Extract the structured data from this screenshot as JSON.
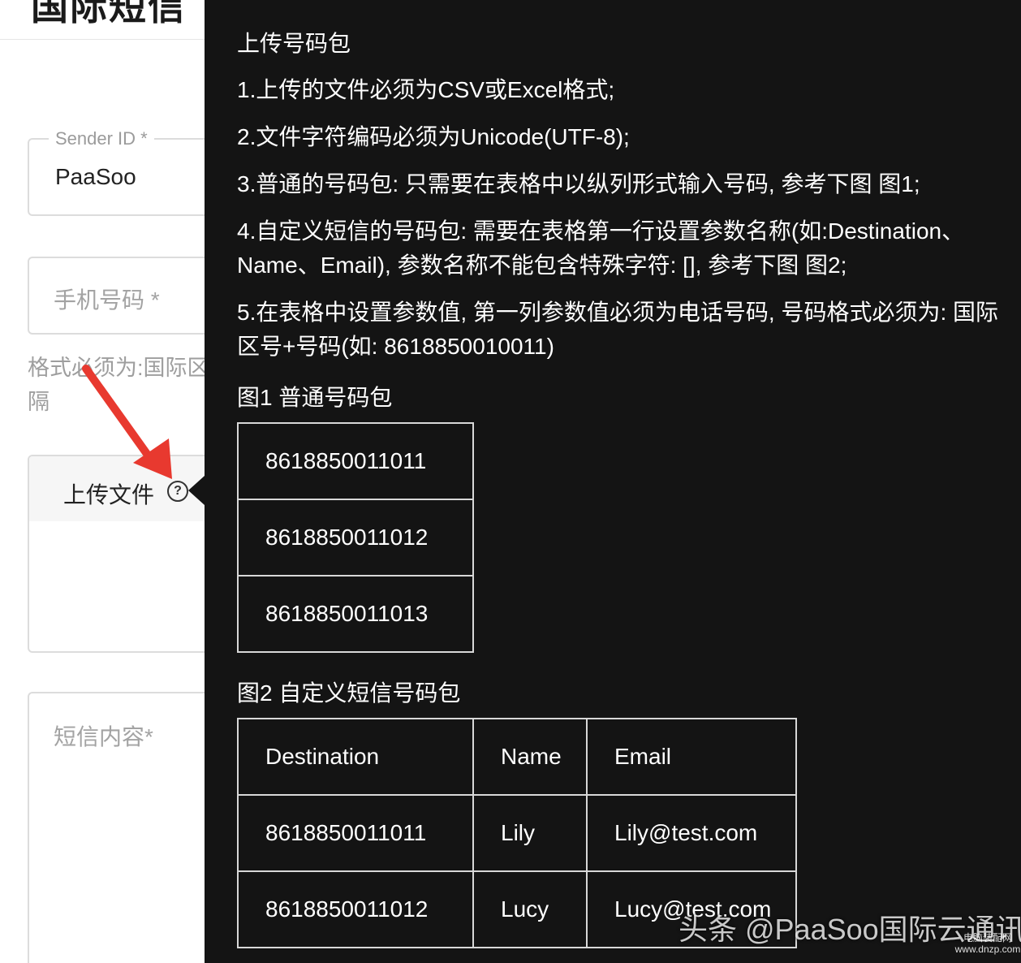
{
  "form": {
    "heading": "国际短信",
    "sender_id": {
      "label": "Sender ID *",
      "value": "PaaSoo"
    },
    "phone": {
      "placeholder": "手机号码 *"
    },
    "phone_hint": "格式必须为:国际区号+号码，多个号码用换行分隔",
    "phone_hint_line1": "格式必须为:国际区",
    "phone_hint_line2": "隔",
    "upload": {
      "label": "上传文件",
      "help_icon": "question-circle-icon"
    },
    "sms_content": {
      "placeholder": "短信内容*"
    }
  },
  "tooltip": {
    "title": "上传号码包",
    "rules": [
      "1.上传的文件必须为CSV或Excel格式;",
      "2.文件字符编码必须为Unicode(UTF-8);",
      "3.普通的号码包: 只需要在表格中以纵列形式输入号码, 参考下图 图1;",
      "4.自定义短信的号码包: 需要在表格第一行设置参数名称(如:Destination、Name、Email), 参数名称不能包含特殊字符: [], 参考下图 图2;",
      "5.在表格中设置参数值, 第一列参数值必须为电话号码, 号码格式必须为: 国际区号+号码(如: 8618850010011)"
    ],
    "figure1": {
      "caption": "图1 普通号码包",
      "rows": [
        "8618850011011",
        "8618850011012",
        "8618850011013"
      ]
    },
    "figure2": {
      "caption": "图2 自定义短信号码包",
      "headers": [
        "Destination",
        "Name",
        "Email"
      ],
      "rows": [
        [
          "8618850011011",
          "Lily",
          "Lily@test.com"
        ],
        [
          "8618850011012",
          "Lucy",
          "Lucy@test.com"
        ]
      ]
    }
  },
  "watermark": {
    "text": "头条 @PaaSoo国际云通讯",
    "small": "电脑装配网 www.dnzp.com"
  },
  "colors": {
    "tooltip_bg": "#141414",
    "arrow": "#e8392f"
  }
}
